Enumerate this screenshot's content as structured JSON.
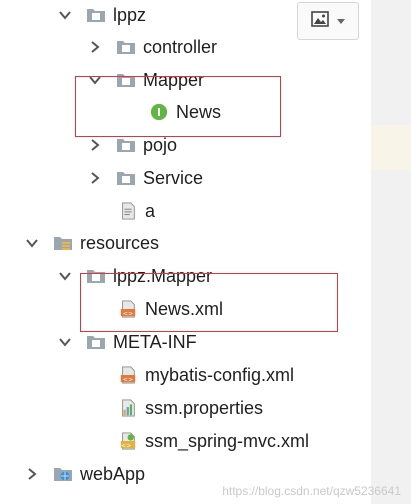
{
  "tree": {
    "rows": [
      {
        "label": "lppz",
        "icon": "package-folder-icon",
        "chevron": "down"
      },
      {
        "label": "controller",
        "icon": "package-folder-icon",
        "chevron": "right"
      },
      {
        "label": "Mapper",
        "icon": "package-folder-icon",
        "chevron": "down"
      },
      {
        "label": "News",
        "icon": "interface-icon",
        "chevron": ""
      },
      {
        "label": "pojo",
        "icon": "package-folder-icon",
        "chevron": "right"
      },
      {
        "label": "Service",
        "icon": "package-folder-icon",
        "chevron": "right"
      },
      {
        "label": "a",
        "icon": "text-file-icon",
        "chevron": ""
      },
      {
        "label": "resources",
        "icon": "resources-folder-icon",
        "chevron": "down"
      },
      {
        "label": "lppz.Mapper",
        "icon": "package-folder-icon",
        "chevron": "down"
      },
      {
        "label": "News.xml",
        "icon": "xml-file-icon",
        "chevron": ""
      },
      {
        "label": "META-INF",
        "icon": "package-folder-icon",
        "chevron": "down"
      },
      {
        "label": "mybatis-config.xml",
        "icon": "xml-file-icon",
        "chevron": ""
      },
      {
        "label": "ssm.properties",
        "icon": "properties-file-icon",
        "chevron": ""
      },
      {
        "label": "ssm_spring-mvc.xml",
        "icon": "spring-xml-file-icon",
        "chevron": ""
      },
      {
        "label": "webApp",
        "icon": "web-folder-icon",
        "chevron": "right"
      }
    ],
    "interface_badge": "I"
  },
  "toolbar": {
    "image_button_icon": "image-icon",
    "dropdown_icon": "caret-down-icon"
  },
  "watermark": "https://blog.csdn.net/qzw5236641",
  "colors": {
    "highlight_border": "#e0343c",
    "folder_gray": "#9aa7b0",
    "interface_green": "#62b543",
    "xml_orange": "#e07a3e",
    "web_blue": "#3d8fd6"
  }
}
